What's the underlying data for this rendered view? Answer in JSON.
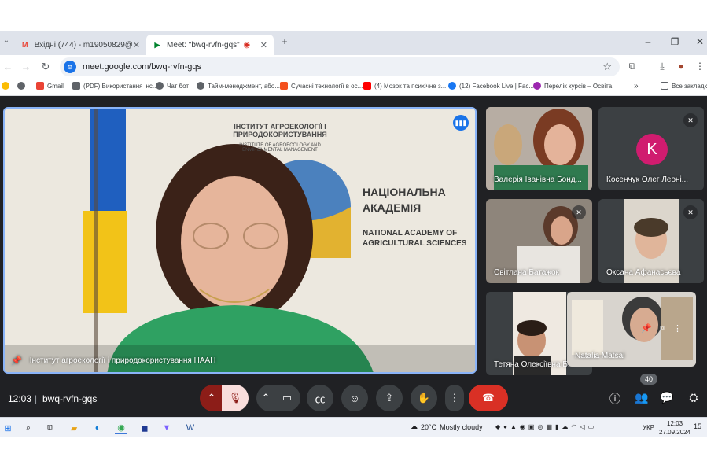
{
  "browser": {
    "tabs": [
      {
        "label": "Вхідні (744) - m19050829@gmail.com",
        "icon": "gmail-icon",
        "active": false
      },
      {
        "label": "Meet: \"bwq-rvfn-gqs\"",
        "icon": "meet-icon",
        "active": true
      }
    ],
    "new_tab": "+",
    "url": "meet.google.com/bwq-rvfn-gqs",
    "bookmarks": [
      {
        "label": "Gmail",
        "color": "#ea4335"
      },
      {
        "label": "(PDF) Використання інс...",
        "color": "#5f6368"
      },
      {
        "label": "Чат бот",
        "color": "#5f6368"
      },
      {
        "label": "Тайм-менеджмент, або...",
        "color": "#5f6368"
      },
      {
        "label": "Сучасні технології в ос...",
        "color": "#f4511e"
      },
      {
        "label": "(4) Мозок та психічне з...",
        "color": "#ff0000"
      },
      {
        "label": "(12) Facebook Live | Fac...",
        "color": "#1877f2"
      },
      {
        "label": "Перелік курсів – Освіта",
        "color": "#9c27b0"
      }
    ],
    "all_bookmarks": "Все закладки"
  },
  "meet": {
    "main_tile": {
      "name": "Інститут агроекології і природокористування НААН",
      "wall_texts": [
        "ІНСТИТУТ АГРОЕКОЛОГІЇ І ПРИРОДОКОРИСТУВАННЯ",
        "INSTITUTE OF AGROECOLOGY AND ENVIRONMENTAL MANAGEMENT",
        "НАЦІОНАЛЬНА АКАДЕМІЯ АГРАРНИХ НАУК",
        "NATIONAL ACADEMY OF AGRICULTURAL SCIENCES"
      ]
    },
    "participants": [
      {
        "name": "Валерія Іванівна Бонд...",
        "muted": false
      },
      {
        "name": "Косенчук Олег Леоні...",
        "muted": true,
        "avatar_letter": "K"
      },
      {
        "name": "Світлана Батажок",
        "muted": true
      },
      {
        "name": "Оксана Афанасьєва",
        "muted": true
      },
      {
        "name": "Тетяна Олексіївна Б...",
        "muted": false
      },
      {
        "name": "Natalia Matsai",
        "muted": false
      }
    ],
    "clock": "12:03",
    "separator": "|",
    "meeting_code": "bwq-rvfn-gqs",
    "participant_count": "40",
    "colors": {
      "end_call": "#d93025",
      "mic_off": "#ea4335",
      "highlight": "#8ab4f8",
      "avatar": "#d01c6f"
    }
  },
  "taskbar": {
    "weather_temp": "20°C",
    "weather_text": "Mostly cloudy",
    "language": "УКР",
    "time": "12:03",
    "date": "27.09.2024",
    "notifications": "15"
  }
}
